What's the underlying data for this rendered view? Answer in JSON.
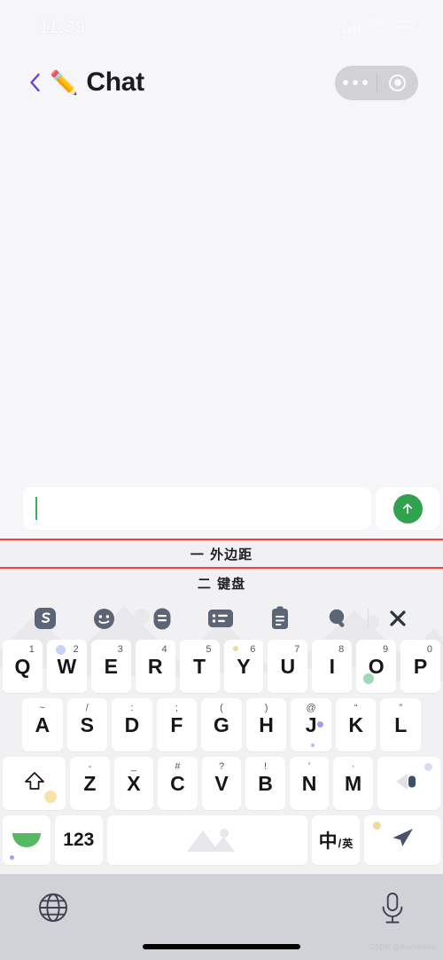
{
  "status_bar": {
    "time": "11:39",
    "signal_icon": "cellular-signal-icon",
    "wifi_icon": "wifi-icon",
    "battery_icon": "battery-icon",
    "battery_label": "64"
  },
  "nav": {
    "back_icon": "back-chevron-icon",
    "back_color": "#6b3ee8",
    "emoji": "✏️",
    "title": "Chat",
    "capsule": {
      "menu_icon": "more-dots-icon",
      "target_icon": "target-circle-icon"
    }
  },
  "input_bar": {
    "text_value": "",
    "placeholder": "",
    "caret_color": "#35b45c",
    "send_icon": "arrow-up-icon",
    "send_color": "#2fa34e"
  },
  "annotations": {
    "line_color": "#f5413d",
    "items": [
      {
        "label": "一 外边距"
      },
      {
        "label": "二 键盘"
      }
    ]
  },
  "keyboard": {
    "toolbar": [
      {
        "icon": "sogou-logo-icon"
      },
      {
        "icon": "emoji-face-icon"
      },
      {
        "icon": "text-settings-icon"
      },
      {
        "icon": "keyboard-card-icon"
      },
      {
        "icon": "clipboard-icon"
      },
      {
        "icon": "search-icon"
      },
      {
        "icon": "close-icon"
      }
    ],
    "row1": [
      {
        "main": "Q",
        "sup": "1"
      },
      {
        "main": "W",
        "sup": "2"
      },
      {
        "main": "E",
        "sup": "3"
      },
      {
        "main": "R",
        "sup": "4"
      },
      {
        "main": "T",
        "sup": "5"
      },
      {
        "main": "Y",
        "sup": "6"
      },
      {
        "main": "U",
        "sup": "7"
      },
      {
        "main": "I",
        "sup": "8"
      },
      {
        "main": "O",
        "sup": "9"
      },
      {
        "main": "P",
        "sup": "0"
      }
    ],
    "row2": [
      {
        "main": "A",
        "sup": "~"
      },
      {
        "main": "S",
        "sup": "/"
      },
      {
        "main": "D",
        "sup": ":"
      },
      {
        "main": "F",
        "sup": ";"
      },
      {
        "main": "G",
        "sup": "("
      },
      {
        "main": "H",
        "sup": ")"
      },
      {
        "main": "J",
        "sup": "@"
      },
      {
        "main": "K",
        "sup": "“"
      },
      {
        "main": "L",
        "sup": "”"
      }
    ],
    "row3": [
      {
        "main": "Z",
        "sup": "-"
      },
      {
        "main": "X",
        "sup": "_"
      },
      {
        "main": "C",
        "sup": "#"
      },
      {
        "main": "V",
        "sup": "?"
      },
      {
        "main": "B",
        "sup": "!"
      },
      {
        "main": "N",
        "sup": "’"
      },
      {
        "main": "M",
        "sup": "·"
      }
    ],
    "shift_icon": "shift-arrow-icon",
    "backspace_icon": "backspace-icon",
    "row4": {
      "emoji_key_icon": "emoji-halfcircle-icon",
      "numeric_label": "123",
      "space_label": "",
      "space_icon": "mountain-watermark-icon",
      "lang_cn": "中",
      "lang_slash": "/",
      "lang_en": "英",
      "send_icon": "paper-plane-icon"
    }
  },
  "bottom_bar": {
    "globe_icon": "globe-icon",
    "mic_icon": "microphone-icon",
    "home_indicator": "home-indicator",
    "watermark": "CSDN @AceVames"
  }
}
